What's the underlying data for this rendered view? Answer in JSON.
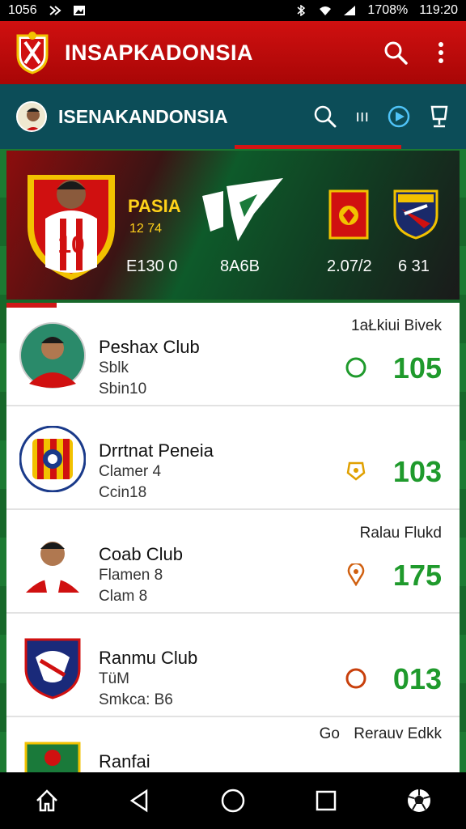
{
  "status_bar": {
    "time_left": "1056",
    "battery": "1708%",
    "time_right": "119:20"
  },
  "app_bar": {
    "title": "INSAPKADONSIA"
  },
  "sub_bar": {
    "title": "ISENAKANDONSIA",
    "action_text": "ııı"
  },
  "banner": {
    "label": "PASIA",
    "sub": "12 74",
    "left_value": "E130 0",
    "center_value": "8A6B",
    "right_value_1": "2.07/2",
    "right_value_2": "6 31",
    "jersey_number": "10"
  },
  "list": [
    {
      "name": "Peshax Club",
      "line2": "Sblk",
      "line3": "Sbin10",
      "tag": "1aŁkiui Bivek",
      "score": "105",
      "icon": "ring-icon",
      "icon_color": "#1f9a2c"
    },
    {
      "name": "Drrtnat Peneia",
      "line2": "Clamer 4",
      "line3": "Ccin18",
      "tag": "",
      "score": "103",
      "icon": "badge-icon",
      "icon_color": "#e0a000"
    },
    {
      "name": "Coab Club",
      "line2": "Flamen 8",
      "line3": "Clam 8",
      "tag": "Ralau Flukd",
      "score": "175",
      "icon": "pin-icon",
      "icon_color": "#d06010"
    },
    {
      "name": "Ranmu Club",
      "line2": "TüM",
      "line3": "Smkca: B6",
      "tag": "",
      "score": "013",
      "icon": "ring-icon",
      "icon_color": "#c8400c"
    },
    {
      "name": "Ranfai",
      "line2": "",
      "line3": "",
      "tag": "Rerauv Edkk",
      "tag2": "Go",
      "score": "",
      "icon": "",
      "icon_color": ""
    }
  ],
  "colors": {
    "primary_red": "#c80c0c",
    "teal": "#0c4d58",
    "score_green": "#1f9a2c"
  }
}
